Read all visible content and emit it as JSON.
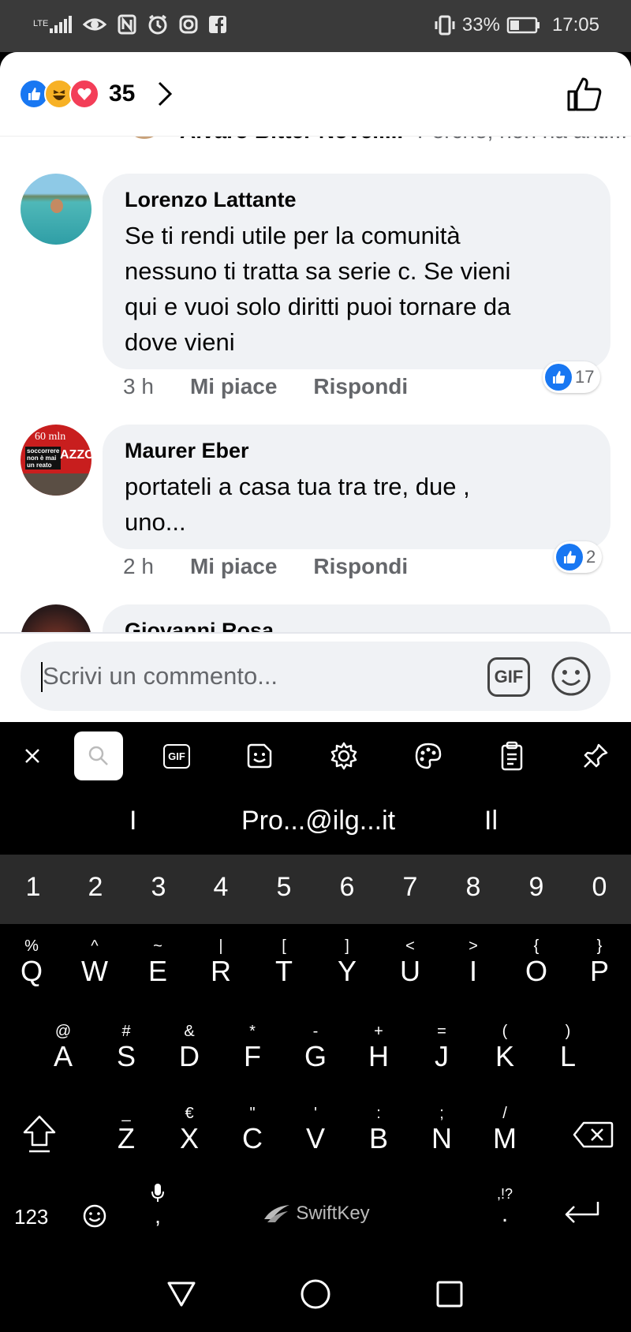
{
  "status_bar": {
    "network": "LTE",
    "battery": "33%",
    "time": "17:05",
    "icons": [
      "signal-icon",
      "eye-icon",
      "nfc-icon",
      "alarm-icon",
      "instagram-icon",
      "facebook-icon",
      "vibrate-icon",
      "battery-icon"
    ]
  },
  "header": {
    "reaction_count": "35",
    "reactions": [
      "like",
      "haha",
      "love"
    ]
  },
  "comments": [
    {
      "name": "Alvaro Bitter Novell...",
      "text": "Perché, non ha anti..."
    },
    {
      "name": "Lorenzo Lattante",
      "lines": [
        "Se ti rendi utile per la comunità",
        "nessuno ti tratta sa serie c. Se vieni",
        "qui e vuoi solo diritti puoi tornare da",
        "dove vieni"
      ],
      "time": "3 h",
      "like_label": "Mi piace",
      "reply_label": "Rispondi",
      "likes": "17"
    },
    {
      "name": "Maurer Eber",
      "lines": [
        "portateli a casa tua tra tre, due ,",
        "uno..."
      ],
      "time": "2 h",
      "like_label": "Mi piace",
      "reply_label": "Rispondi",
      "likes": "2",
      "avatar_text": [
        "60 mln",
        "soccorrere",
        "non è mai",
        "un reato",
        "AZZO"
      ]
    },
    {
      "name": "Giovanni Rosa"
    }
  ],
  "composer": {
    "placeholder": "Scrivi un commento...",
    "gif_label": "GIF"
  },
  "keyboard": {
    "toolbar": [
      "close-icon",
      "search-icon",
      "gif-icon",
      "sticker-icon",
      "settings-icon",
      "theme-icon",
      "clipboard-icon",
      "pin-icon"
    ],
    "toolbar_gif": "GIF",
    "suggestions": [
      "I",
      "Pro...@ilg...it",
      "Il"
    ],
    "numbers": [
      "1",
      "2",
      "3",
      "4",
      "5",
      "6",
      "7",
      "8",
      "9",
      "0"
    ],
    "row1": [
      [
        "%",
        "Q"
      ],
      [
        "^",
        "W"
      ],
      [
        "~",
        "E"
      ],
      [
        "|",
        "R"
      ],
      [
        "[",
        "T"
      ],
      [
        "]",
        "Y"
      ],
      [
        "<",
        "U"
      ],
      [
        ">",
        "I"
      ],
      [
        "{",
        "O"
      ],
      [
        "}",
        "P"
      ]
    ],
    "row2": [
      [
        "@",
        "A"
      ],
      [
        "#",
        "S"
      ],
      [
        "&",
        "D"
      ],
      [
        "*",
        "F"
      ],
      [
        "-",
        "G"
      ],
      [
        "+",
        "H"
      ],
      [
        "=",
        "J"
      ],
      [
        "(",
        "K"
      ],
      [
        ")",
        "L"
      ]
    ],
    "row3": [
      [
        "_",
        "Z"
      ],
      [
        "€",
        "X"
      ],
      [
        "\"",
        "C"
      ],
      [
        "'",
        "V"
      ],
      [
        ":",
        "B"
      ],
      [
        ";",
        "N"
      ],
      [
        "/",
        "M"
      ]
    ],
    "bottom": {
      "num_label": "123",
      "brand": "SwiftKey",
      "punct_sec": ",!?",
      "punct_pri": ".",
      "comma": ","
    }
  }
}
